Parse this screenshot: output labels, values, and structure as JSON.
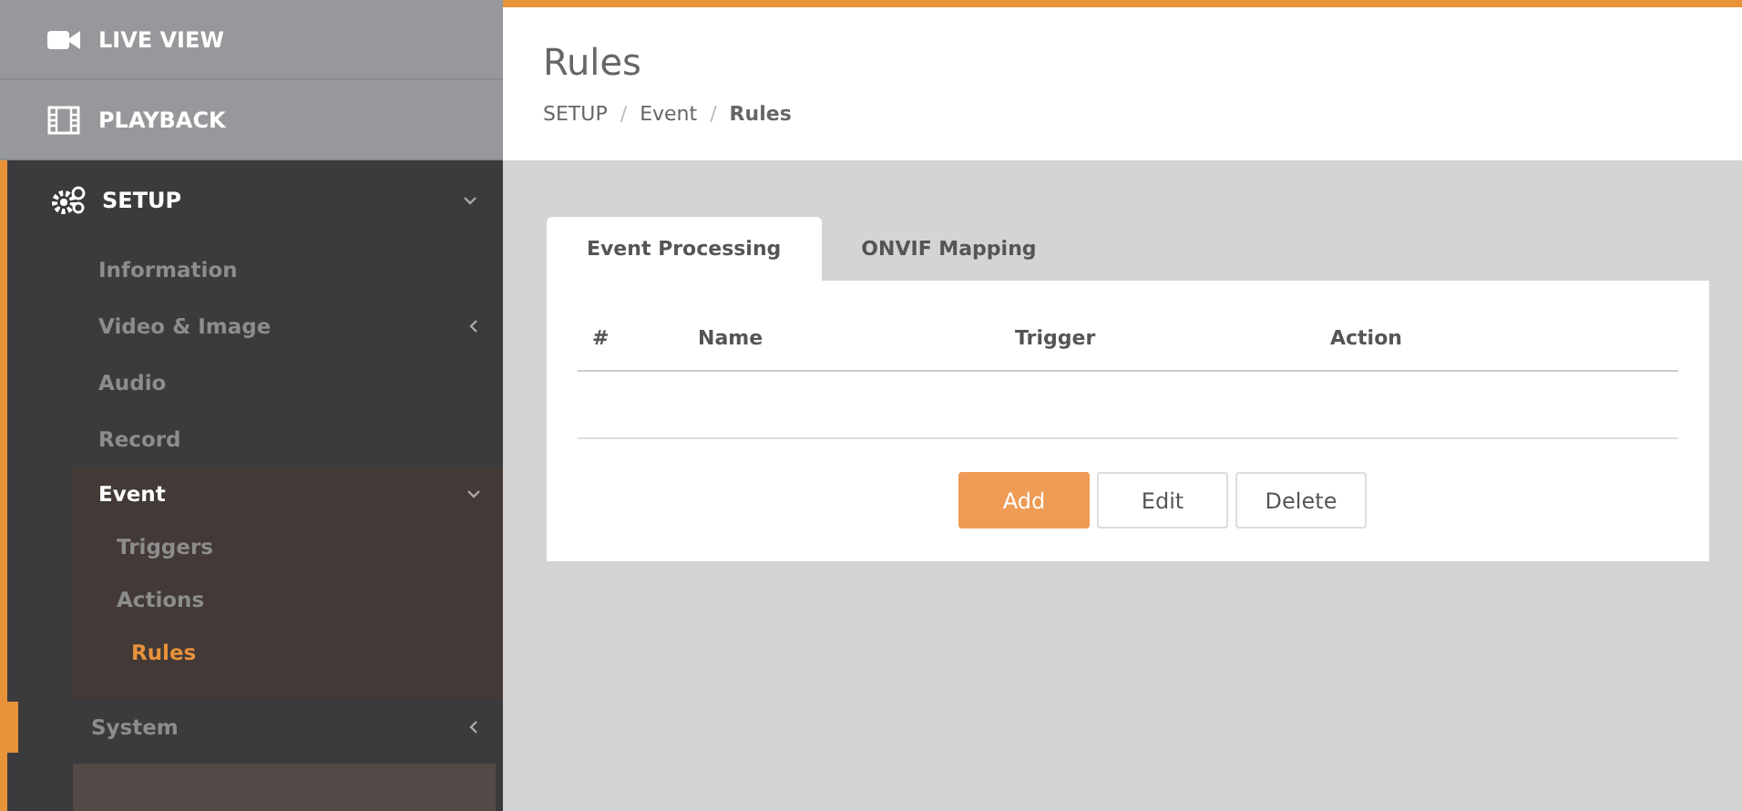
{
  "sidebar": {
    "top_items": [
      {
        "label": "LIVE VIEW",
        "kind": "camera"
      },
      {
        "label": "PLAYBACK",
        "kind": "film"
      }
    ],
    "setup": {
      "label": "SETUP",
      "expanded": true,
      "items": [
        {
          "label": "Information",
          "selected": false
        },
        {
          "label": "Video & Image",
          "selected": false,
          "expanded": false
        },
        {
          "label": "Audio",
          "selected": false
        },
        {
          "label": "Record",
          "selected": false
        },
        {
          "label": "Event",
          "expanded": true,
          "children": [
            {
              "label": "Triggers",
              "selected": false
            },
            {
              "label": "Actions",
              "selected": false
            },
            {
              "label": "Rules",
              "selected": true
            }
          ]
        },
        {
          "label": "System",
          "selected": false,
          "expanded": false,
          "hovered": true
        }
      ]
    }
  },
  "page": {
    "title": "Rules",
    "breadcrumb": [
      "SETUP",
      "Event",
      "Rules"
    ],
    "separator": "/"
  },
  "tabs": [
    {
      "label": "Event Processing",
      "selected": true
    },
    {
      "label": "ONVIF Mapping",
      "selected": false
    }
  ],
  "table": {
    "columns": [
      "#",
      "Name",
      "Trigger",
      "Action"
    ]
  },
  "buttons": [
    {
      "label": "Add",
      "primary": true
    },
    {
      "label": "Edit",
      "primary": false
    },
    {
      "label": "Delete",
      "primary": false
    }
  ]
}
